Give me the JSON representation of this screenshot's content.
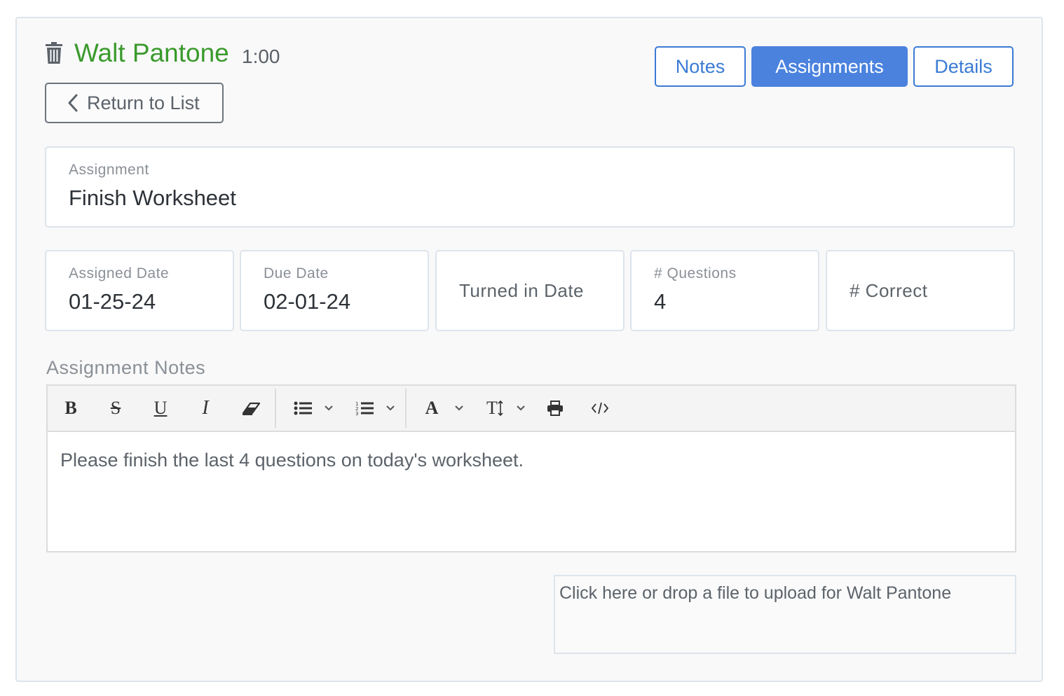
{
  "header": {
    "student_name": "Walt Pantone",
    "duration": "1:00",
    "tabs": [
      {
        "label": "Notes",
        "active": false
      },
      {
        "label": "Assignments",
        "active": true
      },
      {
        "label": "Details",
        "active": false
      }
    ],
    "return_label": "Return to List"
  },
  "assignment": {
    "label": "Assignment",
    "value": "Finish Worksheet"
  },
  "fields": {
    "assigned_date": {
      "label": "Assigned Date",
      "value": "01-25-24"
    },
    "due_date": {
      "label": "Due Date",
      "value": "02-01-24"
    },
    "turned_in_date": {
      "label": "Turned in Date"
    },
    "questions": {
      "label": "# Questions",
      "value": "4"
    },
    "correct": {
      "label": "# Correct"
    }
  },
  "notes": {
    "label": "Assignment Notes",
    "content": "Please finish the last 4 questions on today's worksheet.",
    "toolbar": {
      "bold": "B",
      "strikethrough": "S",
      "underline": "U",
      "italic": "I",
      "font_color": "A",
      "font_size": "T"
    }
  },
  "upload": {
    "text": "Click here or drop a file to upload for Walt Pantone"
  },
  "colors": {
    "accent": "#4a82de",
    "name_green": "#3a9a2c",
    "border": "#dde4ec"
  }
}
